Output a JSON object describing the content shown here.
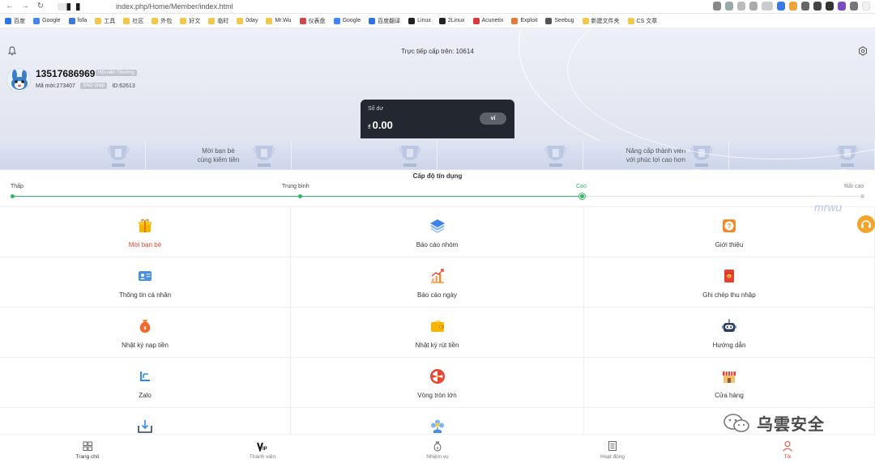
{
  "browser": {
    "url": "index.php/Home/Member/index.html",
    "nav": [
      "←",
      "→",
      "↻"
    ],
    "bookmarks": [
      {
        "label": "百度",
        "color": "#2f74e6"
      },
      {
        "label": "Google",
        "color": "#4285f4"
      },
      {
        "label": "fofa",
        "color": "#3c78d8"
      },
      {
        "label": "工具",
        "color": "#f2c84b"
      },
      {
        "label": "社区",
        "color": "#f2c84b"
      },
      {
        "label": "外包",
        "color": "#f2c84b"
      },
      {
        "label": "好文",
        "color": "#f2c84b"
      },
      {
        "label": "临时",
        "color": "#f2c84b"
      },
      {
        "label": "0day",
        "color": "#f2c84b"
      },
      {
        "label": "Mr.Wu",
        "color": "#f2c84b"
      },
      {
        "label": "仪表盘",
        "color": "#c94b4b"
      },
      {
        "label": "Google",
        "color": "#4285f4"
      },
      {
        "label": "百度翻译",
        "color": "#2f74e6"
      },
      {
        "label": "Linux",
        "color": "#222222"
      },
      {
        "label": "2Linux",
        "color": "#222222"
      },
      {
        "label": "Acunetix",
        "color": "#d63a3a"
      },
      {
        "label": "Exploit",
        "color": "#e07b39"
      },
      {
        "label": "Seebug",
        "color": "#555555"
      },
      {
        "label": "新建文件夹",
        "color": "#f2c84b"
      },
      {
        "label": "CS 文章",
        "color": "#f2c84b"
      }
    ]
  },
  "header": {
    "upper_level_text": "Trực tiếp cấp trên: 10614",
    "phone": "13517686969",
    "member_level": "Hội viên Thường",
    "invite_code": "Mã mời:273407",
    "copy_label": "SAO chép",
    "user_id": "ID:62613"
  },
  "balance": {
    "label": "Số dư",
    "currency": "₫",
    "value": "0.00",
    "wallet_button": "ví"
  },
  "banners": [
    {
      "text": ""
    },
    {
      "text": "Mời bạn bè\ncùng kiếm tiền"
    },
    {
      "text": ""
    },
    {
      "text": ""
    },
    {
      "text": "Nâng cấp thành viên\nvới phúc lợi cao hơn"
    },
    {
      "text": ""
    }
  ],
  "credit": {
    "title": "Cấp độ tín dụng",
    "levels": [
      "Thấp",
      "Trung bình",
      "Cao",
      "Rất cao"
    ],
    "current_level": "Cao",
    "level_fraction": 0.67
  },
  "menu": [
    {
      "label": "Mời bạn bè",
      "icon": "gift-icon",
      "highlight": true
    },
    {
      "label": "Báo cáo nhóm",
      "icon": "layers-icon",
      "highlight": false
    },
    {
      "label": "Giới thiệu",
      "icon": "question-icon",
      "highlight": false
    },
    {
      "label": "Thông tin cá nhân",
      "icon": "id-card-icon",
      "highlight": false
    },
    {
      "label": "Báo cáo ngày",
      "icon": "chart-up-icon",
      "highlight": false
    },
    {
      "label": "Ghi chép thu nhập",
      "icon": "red-envelope-icon",
      "highlight": false
    },
    {
      "label": "Nhật ký nạp tiền",
      "icon": "money-bag-icon",
      "highlight": false
    },
    {
      "label": "Nhật ký rút tiền",
      "icon": "wallet-icon",
      "highlight": false
    },
    {
      "label": "Hướng dẫn",
      "icon": "robot-icon",
      "highlight": false
    },
    {
      "label": "Zalo",
      "icon": "zalo-icon",
      "highlight": false
    },
    {
      "label": "Vòng tròn lớn",
      "icon": "wheel-icon",
      "highlight": false
    },
    {
      "label": "Cửa hàng",
      "icon": "shop-icon",
      "highlight": false
    },
    {
      "label": "",
      "icon": "download-icon",
      "highlight": false
    },
    {
      "label": "",
      "icon": "flower-icon",
      "highlight": false
    },
    {
      "label": "",
      "icon": "",
      "highlight": false
    }
  ],
  "tabs": [
    {
      "label": "Trang chủ",
      "icon": "home-grid-icon"
    },
    {
      "label": "Thành viên",
      "icon": "vip-icon"
    },
    {
      "label": "Nhiệm vụ",
      "icon": "money-bag-outline-icon"
    },
    {
      "label": "Hoạt động",
      "icon": "list-icon"
    },
    {
      "label": "Tôi",
      "icon": "user-icon"
    }
  ],
  "watermarks": {
    "handwritten": "mrwu",
    "wechat": "乌雲安全"
  },
  "colors": {
    "accent_green": "#33b56a",
    "active_red": "#e8412f",
    "card_dark": "#23272f"
  }
}
